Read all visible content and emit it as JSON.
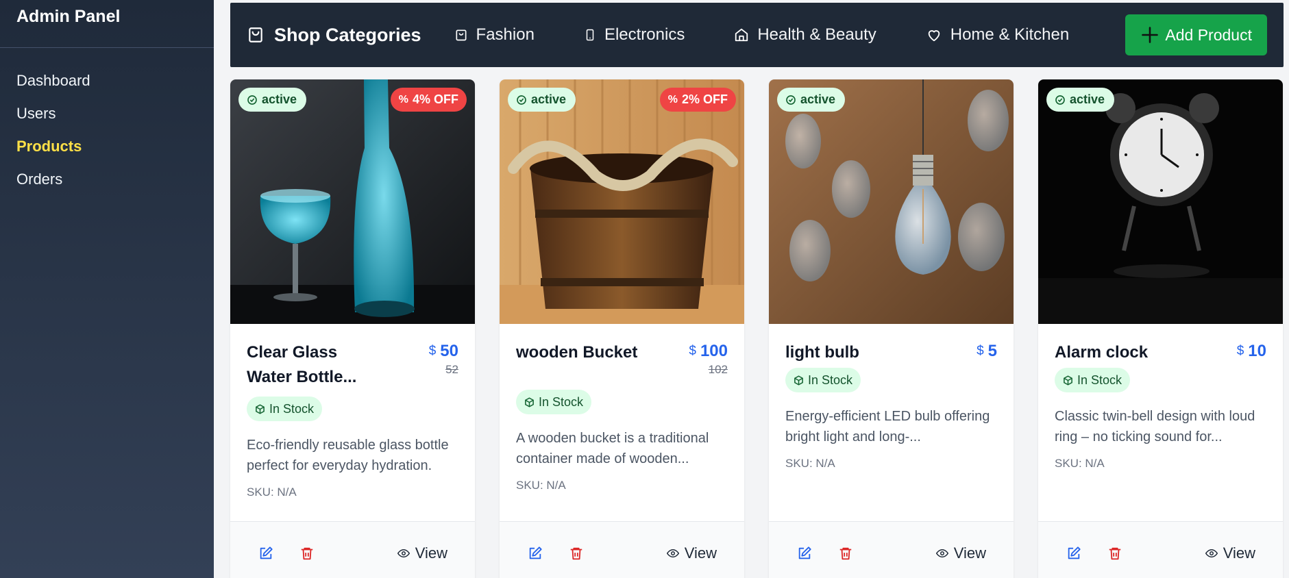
{
  "sidebar": {
    "title": "Admin Panel",
    "items": [
      {
        "label": "Dashboard"
      },
      {
        "label": "Users"
      },
      {
        "label": "Products"
      },
      {
        "label": "Orders"
      }
    ]
  },
  "topbar": {
    "title": "Shop Categories",
    "categories": [
      {
        "label": "Fashion",
        "icon": "bag-icon"
      },
      {
        "label": "Electronics",
        "icon": "phone-icon"
      },
      {
        "label": "Health & Beauty",
        "icon": "home-icon"
      },
      {
        "label": "Home & Kitchen",
        "icon": "heart-icon"
      }
    ],
    "add_label": "Add Product"
  },
  "products": [
    {
      "status": "active",
      "discount": "4% OFF",
      "name": "Clear Glass Water Bottle...",
      "currency": "$",
      "price": "50",
      "old_price": "52",
      "stock": "In Stock",
      "description": "Eco-friendly reusable glass bottle perfect for everyday hydration.",
      "sku": "SKU: N/A",
      "view": "View"
    },
    {
      "status": "active",
      "discount": "2% OFF",
      "name": "wooden Bucket",
      "currency": "$",
      "price": "100",
      "old_price": "102",
      "stock": "In Stock",
      "description": "A wooden bucket is a traditional container made of wooden...",
      "sku": "SKU: N/A",
      "view": "View"
    },
    {
      "status": "active",
      "name": "light bulb",
      "currency": "$",
      "price": "5",
      "stock": "In Stock",
      "description": "Energy-efficient LED bulb offering bright light and long-...",
      "sku": "SKU: N/A",
      "view": "View"
    },
    {
      "status": "active",
      "name": "Alarm clock",
      "currency": "$",
      "price": "10",
      "stock": "In Stock",
      "description": "Classic twin-bell design with loud ring – no ticking sound for...",
      "sku": "SKU: N/A",
      "view": "View"
    }
  ],
  "colors": {
    "accent": "#2563eb",
    "active_nav": "#fde047",
    "add_button": "#16a34a",
    "discount": "#ef4444",
    "delete": "#dc2626"
  }
}
